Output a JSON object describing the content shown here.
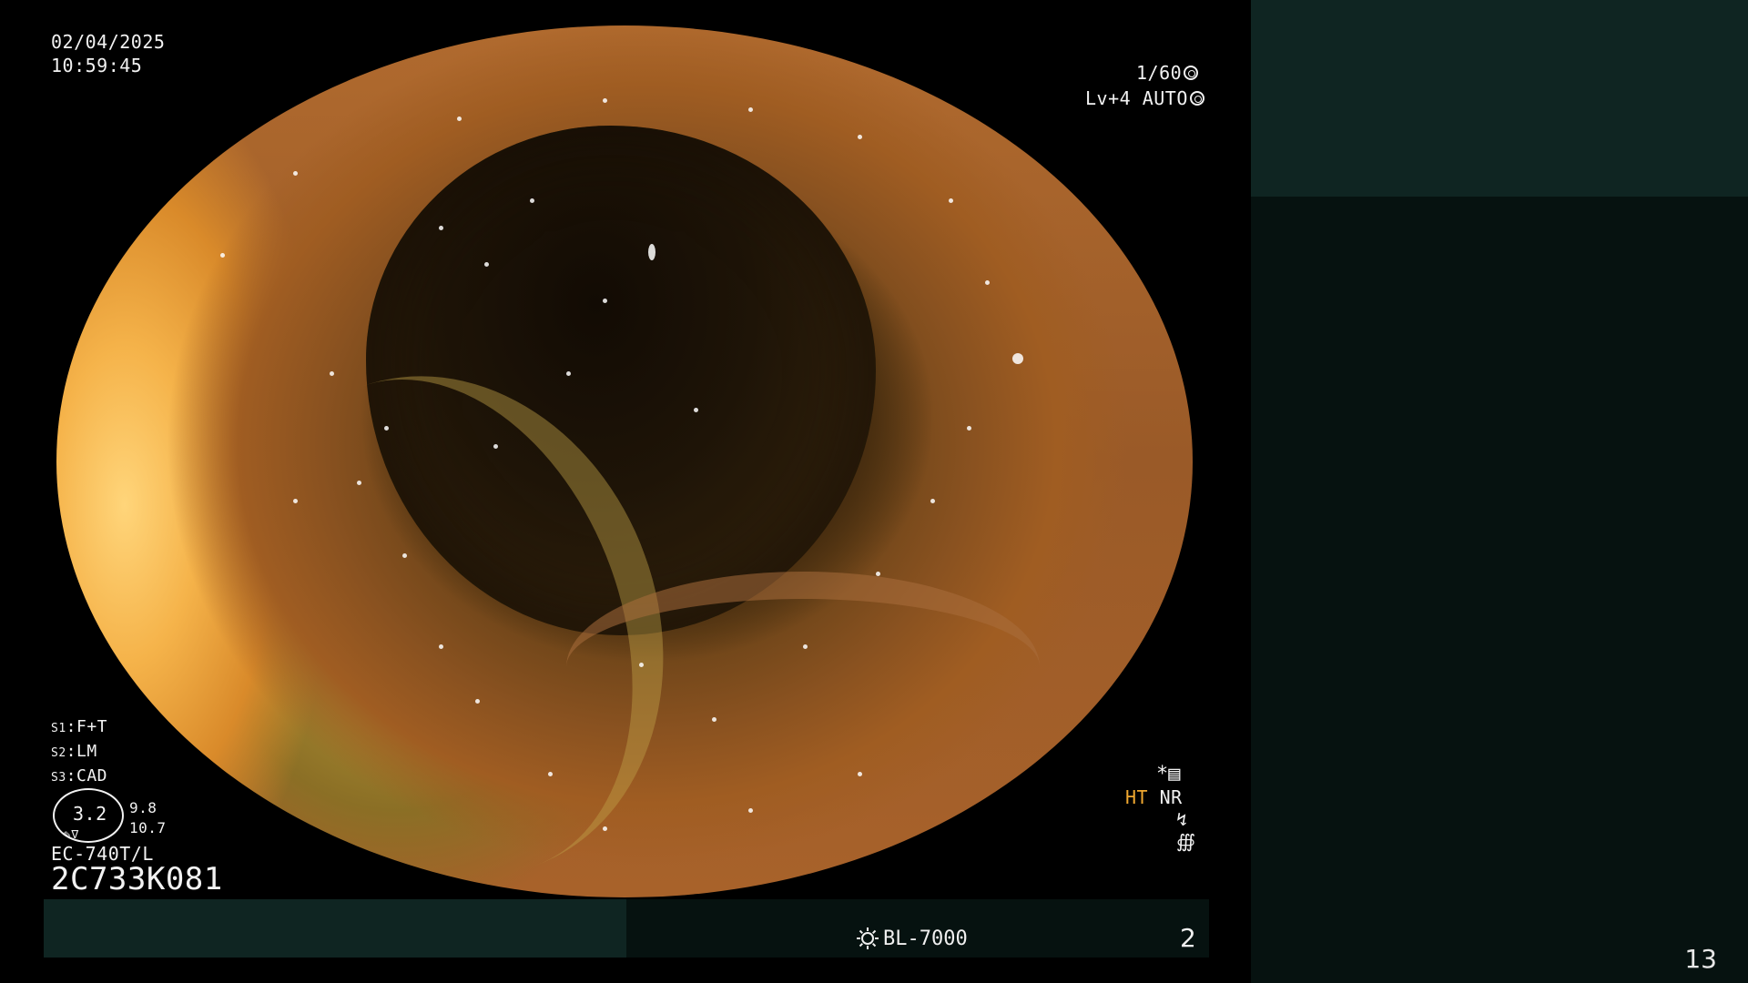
{
  "overlay": {
    "date": "02/04/2025",
    "time": "10:59:45",
    "shutter": "1/60",
    "exposure": "Lv+4 AUTO",
    "settings": [
      {
        "slot": "S1",
        "value": "F+T"
      },
      {
        "slot": "S2",
        "value": "LM"
      },
      {
        "slot": "S3",
        "value": "CAD"
      }
    ],
    "zoom": {
      "main": "3.2",
      "side_top": "9.8",
      "side_bottom": "10.7"
    },
    "scope_model": "EC-740T/L",
    "scope_serial": "2C733K081",
    "enhance_ht": "HT",
    "enhance_nr": "NR",
    "light_source": "BL-7000",
    "frame_number": "2"
  },
  "side_panel": {
    "page_counter": "13"
  },
  "colors": {
    "panel_teal": "#0f2522",
    "panel_dark": "#061210",
    "ht_accent": "#f0a830"
  },
  "icons": [
    "shutter-dial-icon",
    "auto-exposure-icon",
    "settings-menu-icon",
    "sun-icon",
    "zoom-tool-icon"
  ]
}
